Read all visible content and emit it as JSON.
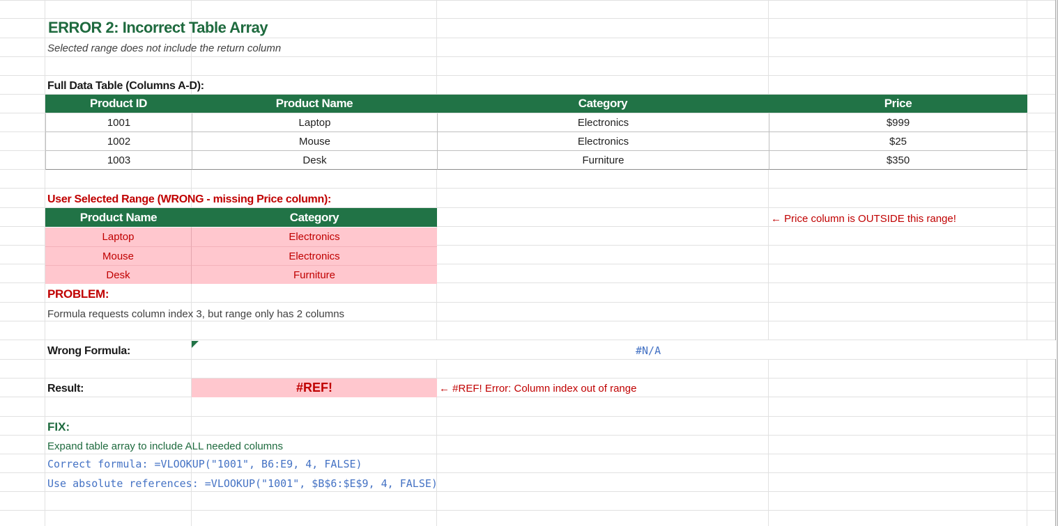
{
  "title": "ERROR 2: Incorrect Table Array",
  "subtitle": "Selected range does not include the return column",
  "full_table": {
    "label": "Full Data Table (Columns A-D):",
    "headers": [
      "Product ID",
      "Product Name",
      "Category",
      "Price"
    ],
    "rows": [
      [
        "1001",
        "Laptop",
        "Electronics",
        "$999"
      ],
      [
        "1002",
        "Mouse",
        "Electronics",
        "$25"
      ],
      [
        "1003",
        "Desk",
        "Furniture",
        "$350"
      ]
    ]
  },
  "selected_range": {
    "label": "User Selected Range (WRONG - missing Price column):",
    "headers": [
      "Product Name",
      "Category"
    ],
    "rows": [
      [
        "Laptop",
        "Electronics"
      ],
      [
        "Mouse",
        "Electronics"
      ],
      [
        "Desk",
        "Furniture"
      ]
    ],
    "note": "← Price column is OUTSIDE this range!"
  },
  "problem": {
    "heading": "PROBLEM:",
    "text": "Formula requests column index 3, but range only has 2 columns"
  },
  "wrong_formula": {
    "label": "Wrong Formula:",
    "value": "#N/A"
  },
  "result": {
    "label": "Result:",
    "value": "#REF!",
    "note": "← #REF! Error: Column index out of range"
  },
  "fix": {
    "heading": "FIX:",
    "line1": "Expand table array to include ALL needed columns",
    "line2": "Correct formula: =VLOOKUP(\"1001\", B6:E9, 4, FALSE)",
    "line3": "Use absolute references: =VLOOKUP(\"1001\", $B$6:$E$9, 4, FALSE)"
  },
  "colors": {
    "header_green": "#217346",
    "error_red": "#c00000",
    "error_fill": "#ffc7ce",
    "formula_blue": "#4472c4"
  }
}
